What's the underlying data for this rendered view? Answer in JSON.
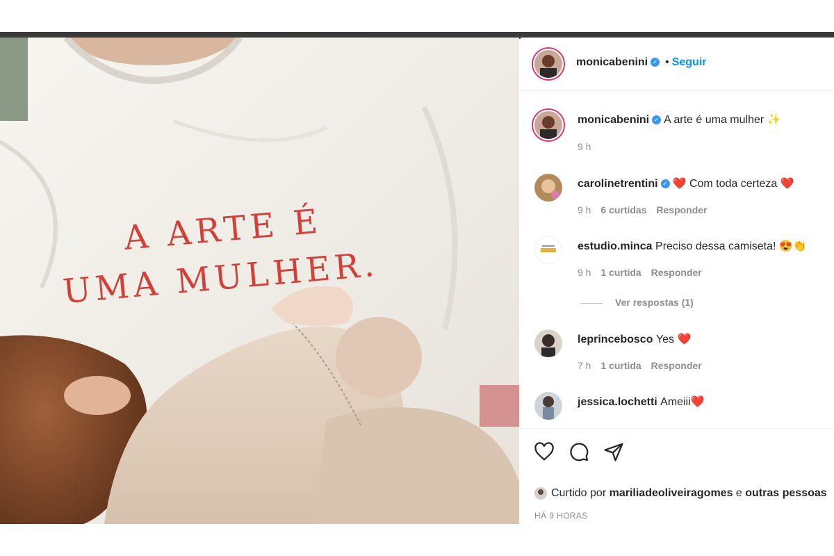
{
  "header": {
    "username": "monicabenini",
    "follow_label": "Seguir"
  },
  "caption": {
    "username": "monicabenini",
    "text": "A arte é uma mulher",
    "emoji": "✨",
    "time": "9 h"
  },
  "shirt_text": {
    "line1": "A ARTE É",
    "line2": "UMA MULHER."
  },
  "comments": [
    {
      "username": "carolinetrentini",
      "verified": true,
      "prefix": "❤️",
      "text": "Com toda certeza",
      "suffix": "❤️",
      "time": "9 h",
      "likes": "6 curtidas",
      "reply": "Responder"
    },
    {
      "username": "estudio.minca",
      "verified": false,
      "text": "Preciso dessa camiseta!",
      "suffix": "😍👏",
      "time": "9 h",
      "likes": "1 curtida",
      "reply": "Responder",
      "view_replies": "Ver respostas (1)"
    },
    {
      "username": "leprincebosco",
      "verified": false,
      "text": "Yes",
      "suffix": "❤️",
      "time": "7 h",
      "likes": "1 curtida",
      "reply": "Responder"
    },
    {
      "username": "jessica.lochetti",
      "verified": false,
      "text": "Ameiii",
      "suffix": "❤️"
    }
  ],
  "likes": {
    "prefix": "Curtido por",
    "user": "mariliadeoliveiragomes",
    "and": "e",
    "others": "outras pessoas"
  },
  "timestamp": "HÁ 9 HORAS",
  "colors": {
    "accent": "#0095f6",
    "verified": "#3897f0",
    "heart": "#e0142b",
    "shirt_text": "#d2403a"
  }
}
